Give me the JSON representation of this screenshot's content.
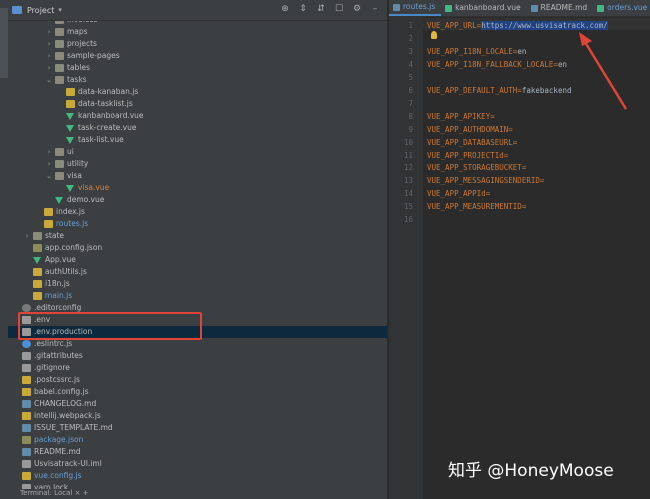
{
  "project_header": {
    "title": "Project",
    "dropdown_glyph": "▾",
    "tools": [
      {
        "icon": "locate-icon",
        "glyph": "⊕"
      },
      {
        "icon": "collapse-icon",
        "glyph": "⇕"
      },
      {
        "icon": "expand-icon",
        "glyph": "⇵"
      },
      {
        "icon": "scroll-from-source-icon",
        "glyph": "☐"
      },
      {
        "icon": "gear-icon",
        "glyph": "⚙"
      },
      {
        "icon": "hide-icon",
        "glyph": "–"
      }
    ]
  },
  "tree": [
    {
      "label": "invoices",
      "type": "folder",
      "expanded": false,
      "indent": 5
    },
    {
      "label": "maps",
      "type": "folder",
      "expanded": false,
      "indent": 5
    },
    {
      "label": "projects",
      "type": "folder",
      "expanded": false,
      "indent": 5
    },
    {
      "label": "sample-pages",
      "type": "folder",
      "expanded": false,
      "indent": 5
    },
    {
      "label": "tables",
      "type": "folder",
      "expanded": false,
      "indent": 5
    },
    {
      "label": "tasks",
      "type": "folder",
      "expanded": true,
      "indent": 5
    },
    {
      "label": "data-kanaban.js",
      "type": "js",
      "indent": 6
    },
    {
      "label": "data-tasklist.js",
      "type": "js",
      "indent": 6
    },
    {
      "label": "kanbanboard.vue",
      "type": "vue",
      "indent": 6
    },
    {
      "label": "task-create.vue",
      "type": "vue",
      "indent": 6
    },
    {
      "label": "task-list.vue",
      "type": "vue",
      "indent": 6
    },
    {
      "label": "ui",
      "type": "folder",
      "expanded": false,
      "indent": 5
    },
    {
      "label": "utility",
      "type": "folder",
      "expanded": false,
      "indent": 5
    },
    {
      "label": "visa",
      "type": "folder",
      "expanded": true,
      "indent": 5
    },
    {
      "label": "visa.vue",
      "type": "vue",
      "indent": 6,
      "color": "orange"
    },
    {
      "label": "demo.vue",
      "type": "vue",
      "indent": 5
    },
    {
      "label": "index.js",
      "type": "js",
      "indent": 4
    },
    {
      "label": "routes.js",
      "type": "js",
      "indent": 4,
      "color": "teal"
    },
    {
      "label": "state",
      "type": "folder",
      "expanded": false,
      "indent": 3
    },
    {
      "label": "app.config.json",
      "type": "json",
      "indent": 3
    },
    {
      "label": "App.vue",
      "type": "vue",
      "indent": 3
    },
    {
      "label": "authUtils.js",
      "type": "js",
      "indent": 3
    },
    {
      "label": "i18n.js",
      "type": "js",
      "indent": 3
    },
    {
      "label": "main.js",
      "type": "js",
      "indent": 3,
      "color": "teal"
    },
    {
      "label": ".editorconfig",
      "type": "gear",
      "indent": 2
    },
    {
      "label": ".env",
      "type": "file",
      "indent": 2
    },
    {
      "label": ".env.production",
      "type": "file",
      "indent": 2,
      "selected": true
    },
    {
      "label": ".eslintrc.js",
      "type": "blue",
      "indent": 2
    },
    {
      "label": ".gitattributes",
      "type": "file",
      "indent": 2
    },
    {
      "label": ".gitignore",
      "type": "file",
      "indent": 2
    },
    {
      "label": ".postcssrc.js",
      "type": "js",
      "indent": 2
    },
    {
      "label": "babel.config.js",
      "type": "js",
      "indent": 2
    },
    {
      "label": "CHANGELOG.md",
      "type": "md",
      "indent": 2
    },
    {
      "label": "intellij.webpack.js",
      "type": "js",
      "indent": 2
    },
    {
      "label": "ISSUE_TEMPLATE.md",
      "type": "md",
      "indent": 2
    },
    {
      "label": "package.json",
      "type": "json",
      "indent": 2,
      "color": "teal"
    },
    {
      "label": "README.md",
      "type": "md",
      "indent": 2
    },
    {
      "label": "Usvisatrack-UI.iml",
      "type": "file",
      "indent": 2
    },
    {
      "label": "vue.config.js",
      "type": "js",
      "indent": 2,
      "color": "teal"
    },
    {
      "label": "yarn.lock",
      "type": "file",
      "indent": 2
    }
  ],
  "bottom_bar": {
    "text": "Terminal: Local × +"
  },
  "editor_tabs": [
    {
      "label": "routes.js",
      "color": "#6a9fd4"
    },
    {
      "label": "kanbanboard.vue",
      "color": "#bbbbbb"
    },
    {
      "label": "README.md",
      "color": "#bbbbbb"
    },
    {
      "label": "orders.vue",
      "color": "#6a9fd4"
    }
  ],
  "code_lines": [
    {
      "num": "1",
      "key": "VUE_APP_URL=",
      "value": "https://www.usvisatrack.com/",
      "highlight": true
    },
    {
      "num": "2",
      "key": "",
      "value": ""
    },
    {
      "num": "3",
      "key": "VUE_APP_I18N_LOCALE=",
      "value": "en"
    },
    {
      "num": "4",
      "key": "VUE_APP_I18N_FALLBACK_LOCALE=",
      "value": "en"
    },
    {
      "num": "5",
      "key": "",
      "value": ""
    },
    {
      "num": "6",
      "key": "VUE_APP_DEFAULT_AUTH=",
      "value": "fakebackend"
    },
    {
      "num": "7",
      "key": "",
      "value": ""
    },
    {
      "num": "8",
      "key": "VUE_APP_APIKEY=",
      "value": ""
    },
    {
      "num": "9",
      "key": "VUE_APP_AUTHDOMAIN=",
      "value": ""
    },
    {
      "num": "10",
      "key": "VUE_APP_DATABASEURL=",
      "value": ""
    },
    {
      "num": "11",
      "key": "VUE_APP_PROJECTId=",
      "value": ""
    },
    {
      "num": "12",
      "key": "VUE_APP_STORAGEBUCKET=",
      "value": ""
    },
    {
      "num": "13",
      "key": "VUE_APP_MESSAGINGSENDERID=",
      "value": ""
    },
    {
      "num": "14",
      "key": "VUE_APP_APPId=",
      "value": ""
    },
    {
      "num": "15",
      "key": "VUE_APP_MEASUREMENTID=",
      "value": ""
    },
    {
      "num": "16",
      "key": "",
      "value": ""
    }
  ],
  "watermark": "知乎 @HoneyMoose",
  "colors": {
    "annotation_red": "#e04437",
    "selection": "#0d293e"
  }
}
